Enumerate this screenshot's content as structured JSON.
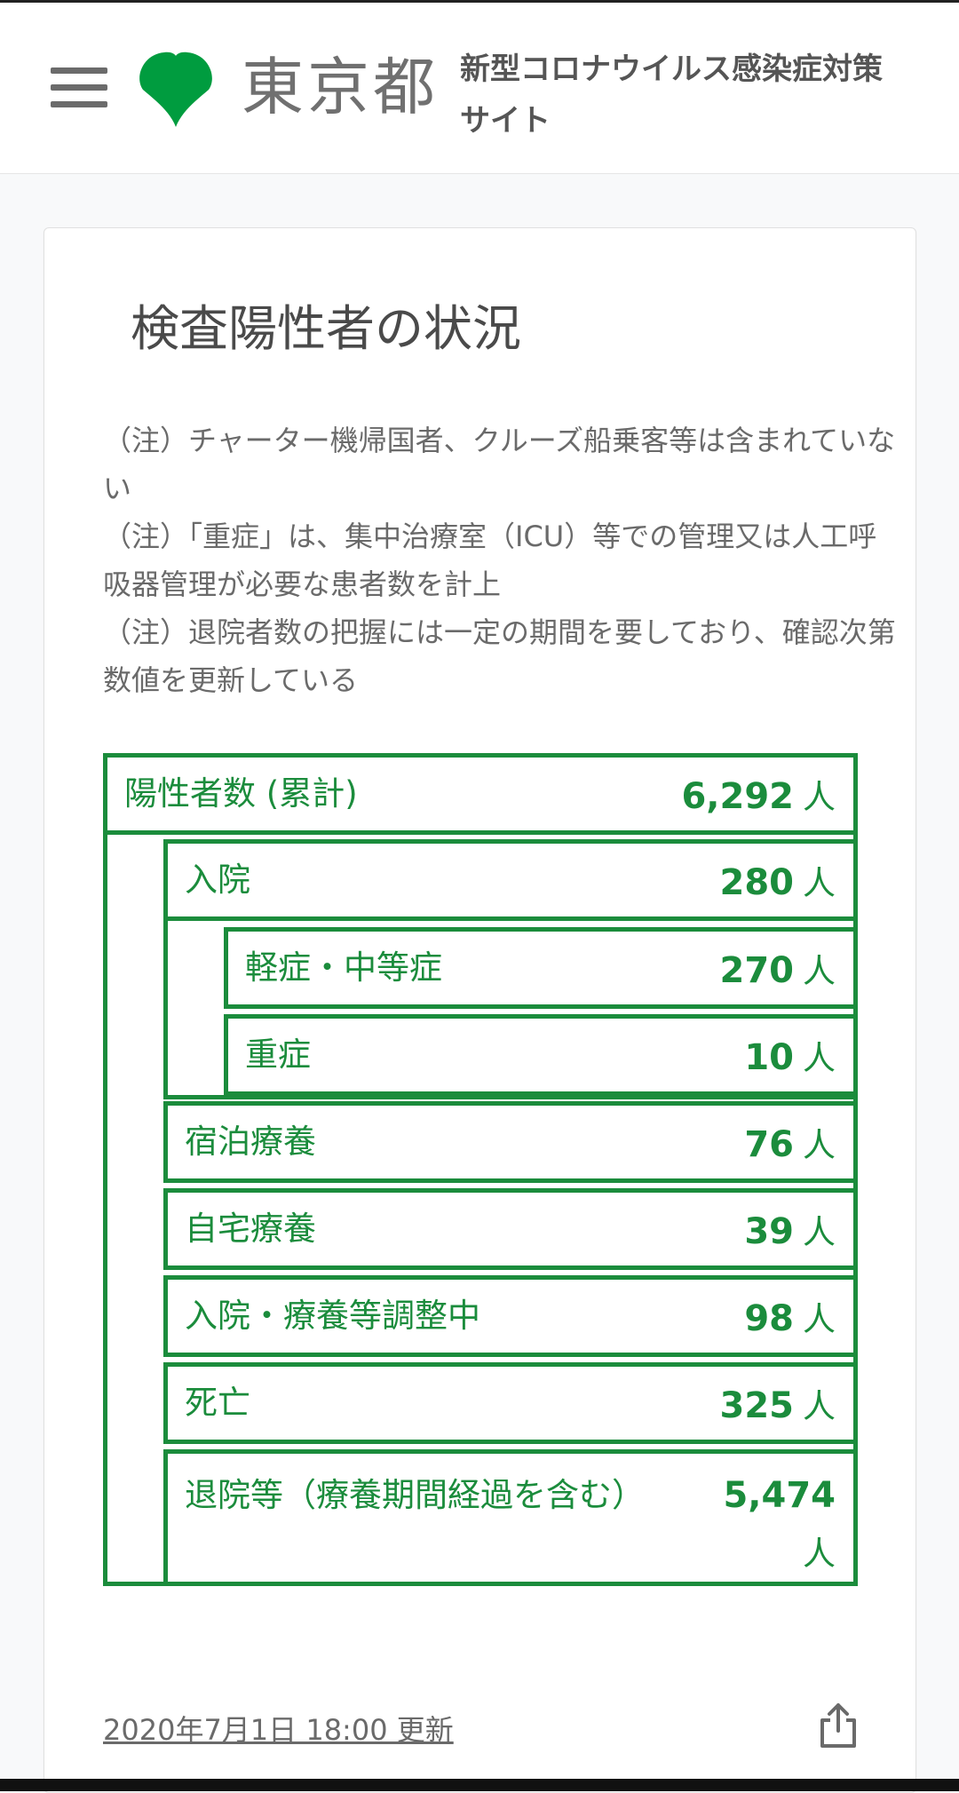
{
  "header": {
    "logo_text": "東京都",
    "site_title": "新型コロナウイルス感染症対策サイト"
  },
  "card": {
    "title": "検査陽性者の状況",
    "notes": [
      "（注）チャーター機帰国者、クルーズ船乗客等は含まれていない",
      "（注）「重症」は、集中治療室（ICU）等での管理又は人工呼吸器管理が必要な患者数を計上",
      "（注）退院者数の把握には一定の期間を要しており、確認次第数値を更新している"
    ],
    "unit": "人",
    "positive": {
      "label": "陽性者数 (累計)",
      "value": "6,292"
    },
    "hospitalized": {
      "label": "入院",
      "value": "280"
    },
    "mild": {
      "label": "軽症・中等症",
      "value": "270"
    },
    "severe": {
      "label": "重症",
      "value": "10"
    },
    "hotel": {
      "label": "宿泊療養",
      "value": "76"
    },
    "home": {
      "label": "自宅療養",
      "value": "39"
    },
    "adjusting": {
      "label": "入院・療養等調整中",
      "value": "98"
    },
    "deaths": {
      "label": "死亡",
      "value": "325"
    },
    "discharged": {
      "label": "退院等（療養期間経過を含む）",
      "value": "5,474"
    },
    "updated": "2020年7月1日 18:00 更新"
  },
  "colors": {
    "accent": "#1b8c3c",
    "logo_green": "#009c3f"
  },
  "icons": {
    "menu": "menu-icon",
    "logo": "ginkgo-logo-icon",
    "share": "share-icon"
  }
}
